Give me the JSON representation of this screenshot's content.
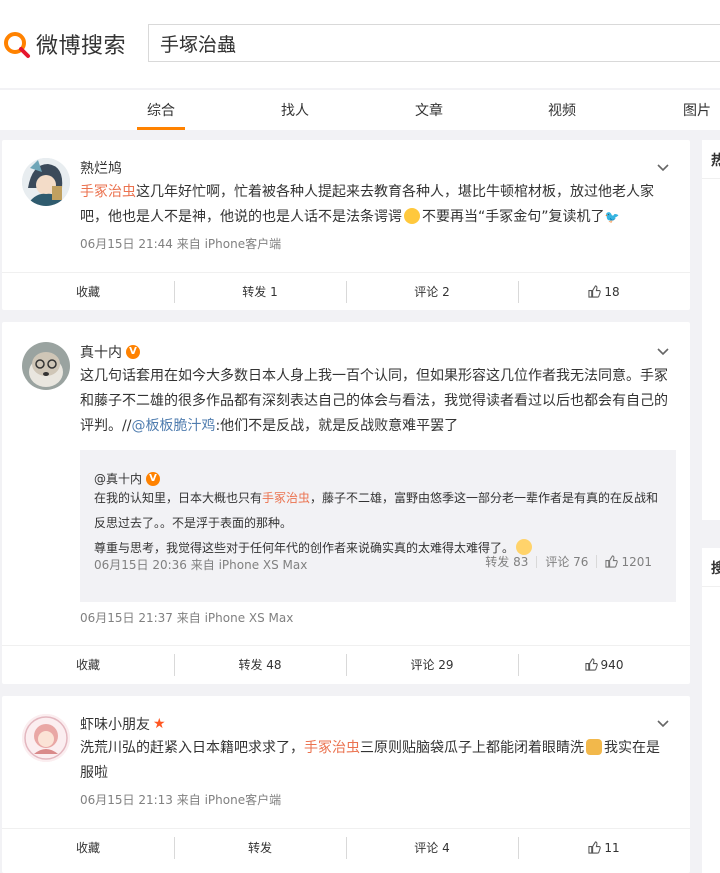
{
  "header": {
    "logo_text": "微博搜索",
    "search_value": "手塚治蟲"
  },
  "tabs": [
    {
      "label": "综合",
      "active": true
    },
    {
      "label": "找人"
    },
    {
      "label": "文章"
    },
    {
      "label": "视频"
    },
    {
      "label": "图片"
    }
  ],
  "posts": [
    {
      "author": "熟烂鸠",
      "text_keyword": "手冢治虫",
      "text_rest": "这几年好忙啊，忙着被各种人提起来去教育各种人，堪比牛顿棺材板，放过他老人家吧，他也是人不是神，他说的也是人话不是法条谔谔",
      "text_rest2": "不要再当“手冢金句”复读机了",
      "meta": "06月15日 21:44  来自 iPhone客户端",
      "actions": {
        "collect": "收藏",
        "repost": "转发 1",
        "comment": "评论 2",
        "like": "18"
      }
    },
    {
      "author": "真十内",
      "text_a": "这几句话套用在如今大多数日本人身上我一百个认同，但如果形容这几位作者我无法同意。手冢和藤子不二雄的很多作品都有深刻表达自己的体会与看法，我觉得读者看过以后也都会有自己的评判。//",
      "text_at": "@板板脆汁鸡",
      "text_b": ":他们不是反战，就是反战败意难平罢了",
      "repost": {
        "author": "@真十内",
        "text_a": "在我的认知里，日本大概也只有",
        "keyword": "手冢治虫",
        "text_b": "，藤子不二雄，富野由悠季这一部分老一辈作者是有真的在反战和反思过去了。。不是浮于表面的那种。",
        "text_c": "尊重与思考，我觉得这些对于任何年代的创作者来说确实真的太难得太难得了。",
        "meta": "06月15日 20:36  来自 iPhone XS Max",
        "repost_count": "转发 83",
        "comment_count": "评论 76",
        "like_count": "1201"
      },
      "meta": "06月15日 21:37  来自 iPhone XS Max",
      "actions": {
        "collect": "收藏",
        "repost": "转发 48",
        "comment": "评论 29",
        "like": "940"
      }
    },
    {
      "author": "虾味小朋友",
      "text_a": "洗荒川弘的赶紧入日本籍吧求求了，",
      "text_keyword": "手冢治虫",
      "text_b": "三原则贴脑袋瓜子上都能闭着眼睛洗",
      "text_c": "我实在是服啦",
      "meta": "06月15日 21:13  来自 iPhone客户端",
      "actions": {
        "collect": "收藏",
        "repost": "转发",
        "comment": "评论 4",
        "like": "11"
      }
    }
  ],
  "sidebar": {
    "label_1": "热",
    "label_2": "搜"
  },
  "colors": {
    "accent": "#ff8200",
    "keyword": "#eb7350",
    "link": "#507daf"
  }
}
